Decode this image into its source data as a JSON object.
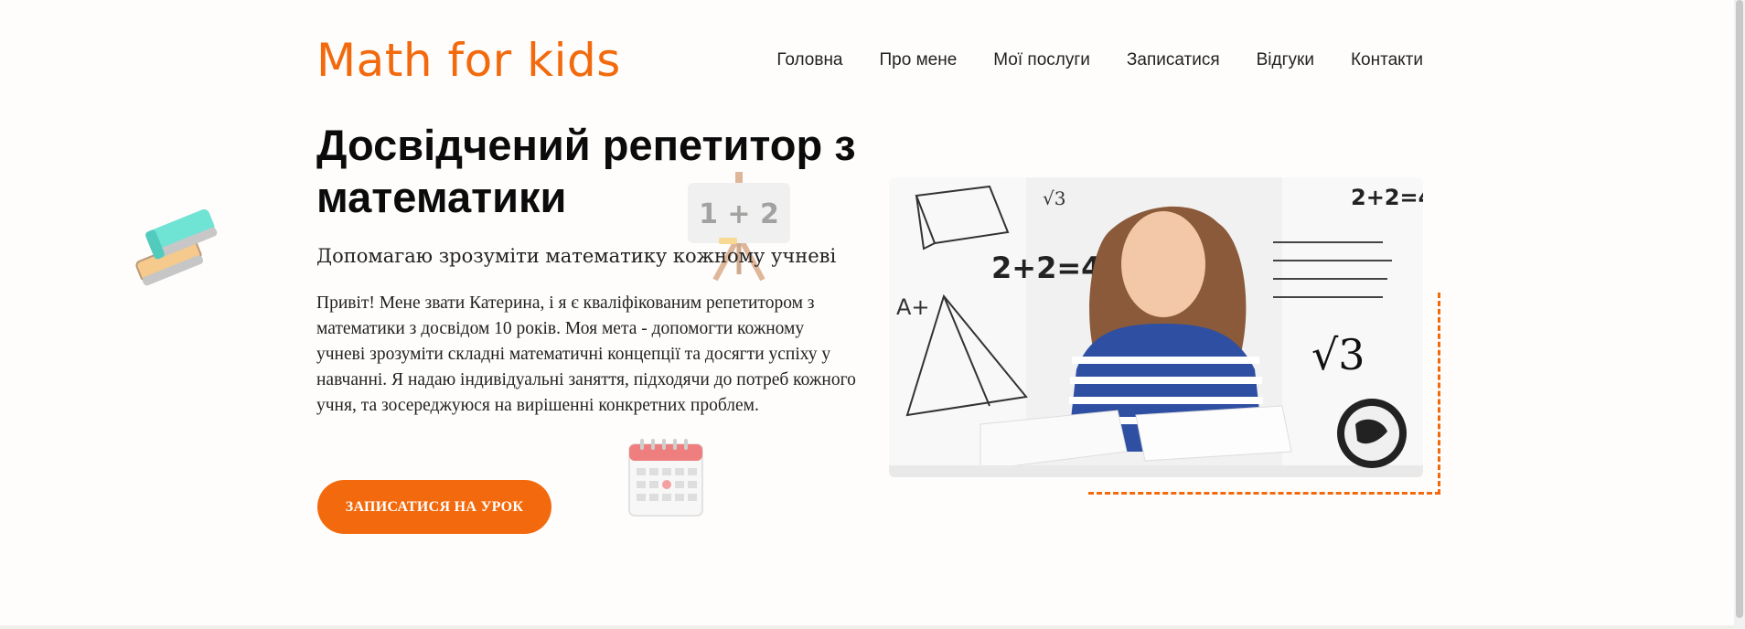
{
  "header": {
    "logo": "Math for kids",
    "nav": [
      "Головна",
      "Про мене",
      "Мої послуги",
      "Записатися",
      "Відгуки",
      "Контакти"
    ]
  },
  "hero": {
    "title": "Досвідчений репетитор з математики",
    "subtitle": "Допомагаю зрозуміти математику кожному учневі",
    "text": "Привіт! Мене звати Катерина, і я є кваліфікованим репетитором з математики з досвідом 10 років. Моя мета - допомогти кожному учневі зрозуміти складні математичні концепції та досягти успіху у навчанні. Я надаю індивідуальні заняття, підходячи до потреб кожного учня, та зосереджуюся на вирішенні конкретних проблем.",
    "cta": "ЗАПИСАТИСЯ НА УРОК",
    "easel_text": "1 + 2"
  },
  "photo": {
    "notes": [
      "2+2=4",
      "2+2=4",
      "√3",
      "A+",
      "√3"
    ]
  },
  "colors": {
    "accent": "#f26a0d",
    "text": "#111111",
    "background": "#fffdfc"
  },
  "icons": [
    "book-stack-icon",
    "easel-icon",
    "calendar-icon"
  ]
}
